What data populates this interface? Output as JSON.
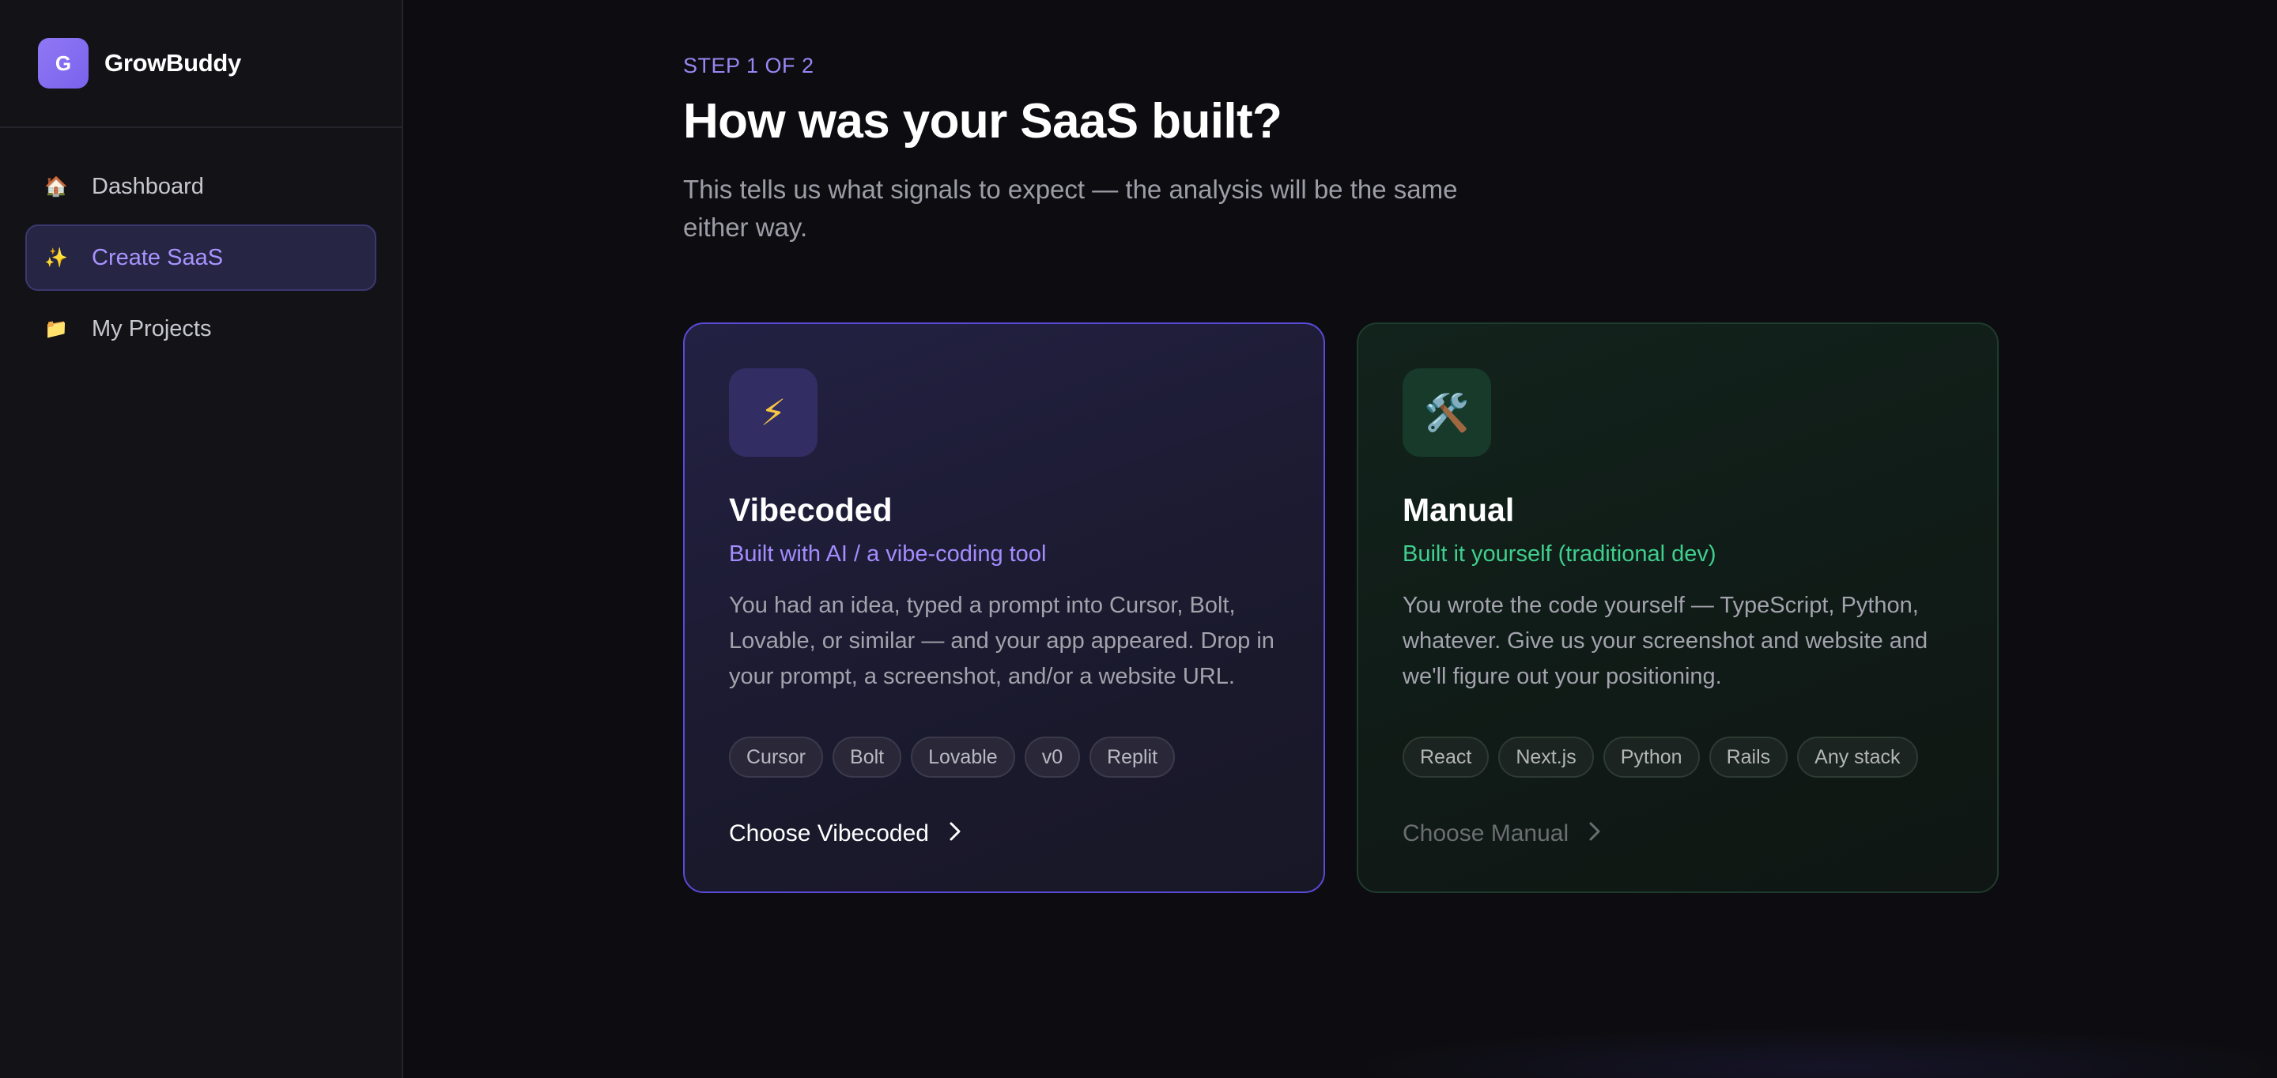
{
  "brand": {
    "logo_letter": "G",
    "name": "GrowBuddy"
  },
  "sidebar": {
    "items": [
      {
        "icon": "🏠",
        "icon_name": "house-icon",
        "label": "Dashboard",
        "active": false
      },
      {
        "icon": "✨",
        "icon_name": "sparkles-icon",
        "label": "Create SaaS",
        "active": true
      },
      {
        "icon": "📁",
        "icon_name": "folder-icon",
        "label": "My Projects",
        "active": false
      }
    ]
  },
  "main": {
    "step": "STEP 1 OF 2",
    "title": "How was your SaaS built?",
    "subtitle": "This tells us what signals to expect — the analysis will be the same either way.",
    "cards": [
      {
        "id": "vibecoded",
        "icon": "⚡",
        "icon_name": "lightning-icon",
        "title": "Vibecoded",
        "tagline": "Built with AI / a vibe-coding tool",
        "description": "You had an idea, typed a prompt into Cursor, Bolt, Lovable, or similar — and your app appeared. Drop in your prompt, a screenshot, and/or a website URL.",
        "tags": [
          "Cursor",
          "Bolt",
          "Lovable",
          "v0",
          "Replit"
        ],
        "cta": "Choose Vibecoded"
      },
      {
        "id": "manual",
        "icon": "🛠️",
        "icon_name": "hammer-wrench-icon",
        "title": "Manual",
        "tagline": "Built it yourself (traditional dev)",
        "description": "You wrote the code yourself — TypeScript, Python, whatever. Give us your screenshot and website and we'll figure out your positioning.",
        "tags": [
          "React",
          "Next.js",
          "Python",
          "Rails",
          "Any stack"
        ],
        "cta": "Choose Manual"
      }
    ]
  },
  "colors": {
    "accent_purple": "#a48cff",
    "accent_green": "#3fcf8e",
    "background": "#0d0d11"
  }
}
